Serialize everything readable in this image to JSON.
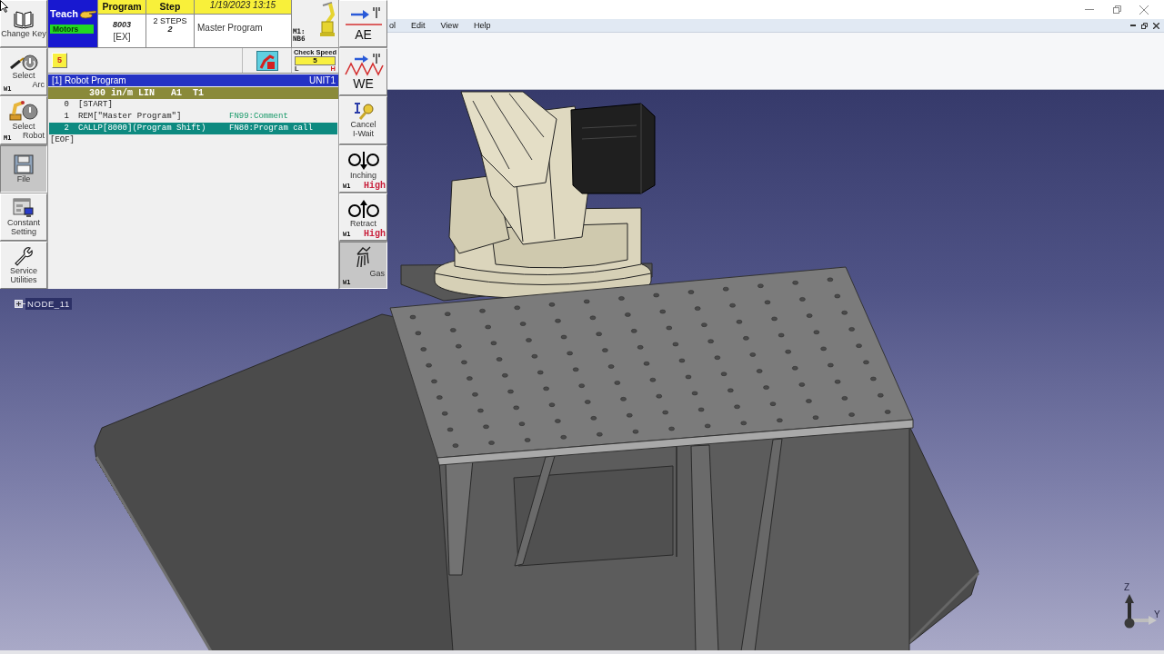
{
  "window": {
    "menu": [
      {
        "label": "ol"
      },
      {
        "label": "Edit"
      },
      {
        "label": "View"
      },
      {
        "label": "Help"
      }
    ]
  },
  "pendant": {
    "left_buttons": [
      {
        "lines": [
          "Change Key"
        ],
        "pressed": false
      },
      {
        "lines": [
          "Select",
          "Arc"
        ],
        "tag": "W1",
        "pressed": false
      },
      {
        "lines": [
          "Select",
          "Robot"
        ],
        "tag": "M1",
        "pressed": false
      },
      {
        "lines": [
          "File"
        ],
        "pressed": true
      },
      {
        "lines": [
          "Constant",
          "Setting"
        ],
        "pressed": false
      },
      {
        "lines": [
          "Service",
          "Utilities"
        ],
        "pressed": false
      }
    ],
    "mode": {
      "label": "Teach",
      "motors": "Motors"
    },
    "program": {
      "heading": "Program",
      "number": "8003",
      "type": "[EX]"
    },
    "step": {
      "heading": "Step",
      "count": "2 STEPS",
      "current": "2"
    },
    "datetime": {
      "heading": "1/19/2023 13:15",
      "name": "Master Program"
    },
    "robot": {
      "lines": [
        "M1:",
        "NB6"
      ]
    },
    "speed_badge": "5",
    "check_speed": {
      "label": "Check Speed",
      "value": "5",
      "low": "L",
      "high": "H"
    },
    "program_window": {
      "title": "[1] Robot Program",
      "unit": "UNIT1",
      "status": "300 in/m LIN   A1  T1",
      "lines": [
        {
          "number": "0",
          "code": "[START]",
          "selected": false
        },
        {
          "number": "1",
          "code": "REM[\"Master Program\"]",
          "note": "FN99:Comment",
          "selected": false
        },
        {
          "number": "2",
          "code": "CALLP[8000](Program Shift)",
          "note": "FN80:Program call",
          "selected": true
        }
      ],
      "end": "[EOF]"
    },
    "right_buttons": [
      {
        "lines": [
          "AE"
        ],
        "pressed": false
      },
      {
        "lines": [
          "WE"
        ],
        "pressed": false
      },
      {
        "lines": [
          "Cancel",
          "I-Wait"
        ],
        "pressed": false
      },
      {
        "lines": [
          "Inching"
        ],
        "tag": "W1",
        "speed": "High",
        "pressed": false
      },
      {
        "lines": [
          "Retract"
        ],
        "tag": "W1",
        "speed": "High",
        "pressed": false
      },
      {
        "lines": [
          "Gas"
        ],
        "tag": "W1",
        "pressed": true
      }
    ]
  },
  "viewport": {
    "tree": [
      {
        "label": "NODE_11",
        "selected": true,
        "expanded": false
      }
    ],
    "axes": {
      "z": "Z",
      "y": "Y"
    }
  }
}
